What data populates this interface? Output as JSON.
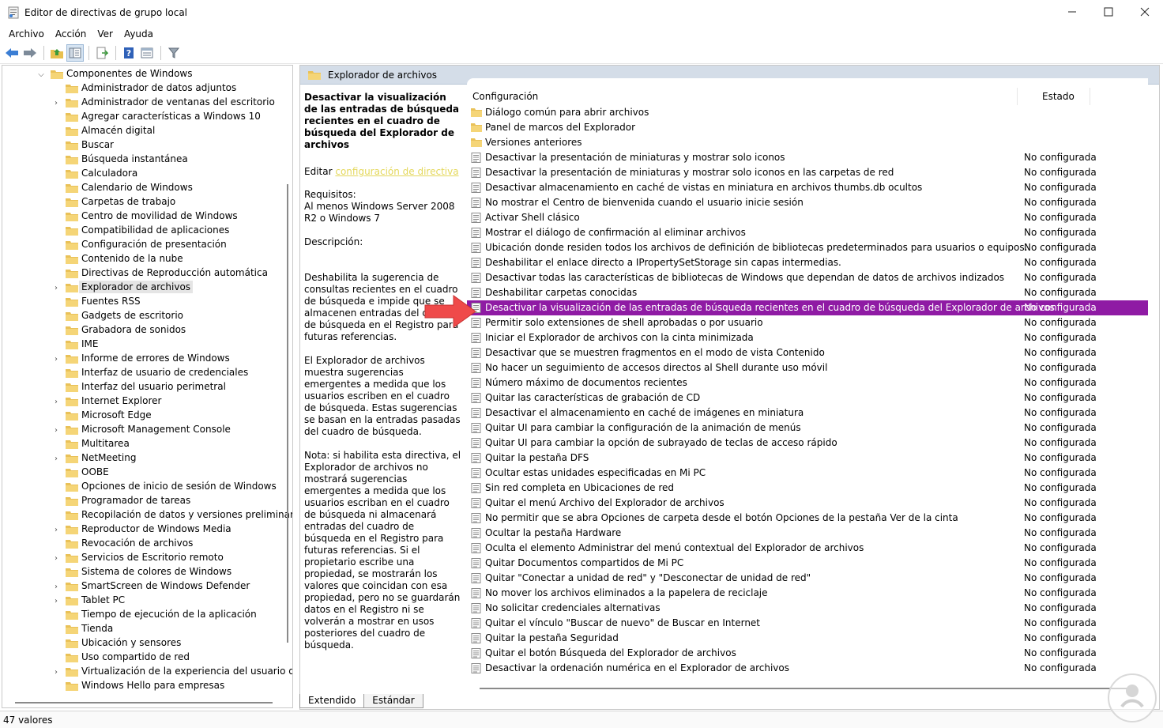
{
  "window": {
    "title": "Editor de directivas de grupo local",
    "minimize_icon": "minimize-icon",
    "maximize_icon": "maximize-icon",
    "close_icon": "close-icon"
  },
  "menu": [
    "Archivo",
    "Acción",
    "Ver",
    "Ayuda"
  ],
  "toolbar": [
    "back-arrow-icon",
    "forward-arrow-icon",
    "up-folder-icon",
    "show-hide-tree-icon",
    "export-list-icon",
    "help-icon",
    "properties-icon",
    "filter-icon"
  ],
  "tree": {
    "root": "Componentes de Windows",
    "items": [
      {
        "label": "Administrador de datos adjuntos",
        "expandable": false
      },
      {
        "label": "Administrador de ventanas del escritorio",
        "expandable": true
      },
      {
        "label": "Agregar características a Windows 10",
        "expandable": false
      },
      {
        "label": "Almacén digital",
        "expandable": false
      },
      {
        "label": "Buscar",
        "expandable": false
      },
      {
        "label": "Búsqueda instantánea",
        "expandable": false
      },
      {
        "label": "Calculadora",
        "expandable": false
      },
      {
        "label": "Calendario de Windows",
        "expandable": false
      },
      {
        "label": "Carpetas de trabajo",
        "expandable": false
      },
      {
        "label": "Centro de movilidad de Windows",
        "expandable": false
      },
      {
        "label": "Compatibilidad de aplicaciones",
        "expandable": false
      },
      {
        "label": "Configuración de presentación",
        "expandable": false
      },
      {
        "label": "Contenido de la nube",
        "expandable": false
      },
      {
        "label": "Directivas de Reproducción automática",
        "expandable": false
      },
      {
        "label": "Explorador de archivos",
        "expandable": true,
        "selected": true
      },
      {
        "label": "Fuentes RSS",
        "expandable": false
      },
      {
        "label": "Gadgets de escritorio",
        "expandable": false
      },
      {
        "label": "Grabadora de sonidos",
        "expandable": false
      },
      {
        "label": "IME",
        "expandable": false
      },
      {
        "label": "Informe de errores de Windows",
        "expandable": true
      },
      {
        "label": "Interfaz de usuario de credenciales",
        "expandable": false
      },
      {
        "label": "Interfaz del usuario perimetral",
        "expandable": false
      },
      {
        "label": "Internet Explorer",
        "expandable": true
      },
      {
        "label": "Microsoft Edge",
        "expandable": false
      },
      {
        "label": "Microsoft Management Console",
        "expandable": true
      },
      {
        "label": "Multitarea",
        "expandable": false
      },
      {
        "label": "NetMeeting",
        "expandable": true
      },
      {
        "label": "OOBE",
        "expandable": false
      },
      {
        "label": "Opciones de inicio de sesión de Windows",
        "expandable": false
      },
      {
        "label": "Programador de tareas",
        "expandable": false
      },
      {
        "label": "Recopilación de datos y versiones preliminares",
        "expandable": false
      },
      {
        "label": "Reproductor de Windows Media",
        "expandable": true
      },
      {
        "label": "Revocación de archivos",
        "expandable": false
      },
      {
        "label": "Servicios de Escritorio remoto",
        "expandable": true
      },
      {
        "label": "Sistema de colores de Windows",
        "expandable": false
      },
      {
        "label": "SmartScreen de Windows Defender",
        "expandable": true
      },
      {
        "label": "Tablet PC",
        "expandable": true
      },
      {
        "label": "Tiempo de ejecución de la aplicación",
        "expandable": false
      },
      {
        "label": "Tienda",
        "expandable": false
      },
      {
        "label": "Ubicación y sensores",
        "expandable": false
      },
      {
        "label": "Uso compartido de red",
        "expandable": false
      },
      {
        "label": "Virtualización de la experiencia del usuario de M",
        "expandable": true
      },
      {
        "label": "Windows Hello para empresas",
        "expandable": false
      }
    ]
  },
  "right_header": "Explorador de archivos",
  "description": {
    "title": "Desactivar la visualización de las entradas de búsqueda recientes en el cuadro de búsqueda del Explorador de archivos",
    "edit_prefix": "Editar",
    "edit_link": "configuración de directiva",
    "requirements_label": "Requisitos:",
    "requirements_text": "Al menos Windows Server 2008 R2 o Windows 7",
    "description_label": "Descripción:",
    "para1": "Deshabilita la sugerencia de consultas recientes en el cuadro de búsqueda e impide que se almacenen entradas del cuadro de búsqueda en el Registro para futuras referencias.",
    "para2": "El Explorador de archivos muestra sugerencias emergentes a medida que los usuarios escriben en el cuadro de búsqueda.  Estas sugerencias se basan en la entradas pasadas del cuadro de búsqueda.",
    "para3": "Nota: si habilita esta directiva, el Explorador de archivos no mostrará sugerencias emergentes a medida que los usuarios escriban en el cuadro de búsqueda ni almacenará entradas del cuadro de búsqueda en el Registro para futuras referencias.  Si el propietario escribe una propiedad, se mostrarán los valores que coincidan con esa propiedad, pero no se guardarán datos en el Registro ni se volverán a mostrar en usos posteriores del cuadro de búsqueda."
  },
  "list": {
    "col_setting": "Configuración",
    "col_state": "Estado",
    "rows": [
      {
        "type": "folder",
        "name": "Diálogo común para abrir archivos",
        "state": ""
      },
      {
        "type": "folder",
        "name": "Panel de marcos del Explorador",
        "state": ""
      },
      {
        "type": "folder",
        "name": "Versiones anteriores",
        "state": ""
      },
      {
        "type": "policy",
        "name": "Desactivar la presentación de miniaturas y mostrar solo iconos",
        "state": "No configurada"
      },
      {
        "type": "policy",
        "name": "Desactivar la presentación de miniaturas y mostrar solo iconos en las carpetas de red",
        "state": "No configurada"
      },
      {
        "type": "policy",
        "name": "Desactivar almacenamiento en caché de vistas en miniatura en archivos thumbs.db ocultos",
        "state": "No configurada"
      },
      {
        "type": "policy",
        "name": "No mostrar el Centro de bienvenida cuando el usuario inicie sesión",
        "state": "No configurada"
      },
      {
        "type": "policy",
        "name": "Activar Shell clásico",
        "state": "No configurada"
      },
      {
        "type": "policy",
        "name": "Mostrar el diálogo de confirmación al eliminar archivos",
        "state": "No configurada"
      },
      {
        "type": "policy",
        "name": "Ubicación donde residen todos los archivos de definición de bibliotecas predeterminados para usuarios o equipos.",
        "state": "No configurada"
      },
      {
        "type": "policy",
        "name": "Deshabilitar el enlace directo a IPropertySetStorage sin capas intermedias.",
        "state": "No configurada"
      },
      {
        "type": "policy",
        "name": "Desactivar todas las características de bibliotecas de Windows que dependan de datos de archivos indizados",
        "state": "No configurada"
      },
      {
        "type": "policy",
        "name": "Deshabilitar carpetas conocidas",
        "state": "No configurada"
      },
      {
        "type": "policy",
        "name": "Desactivar la visualización de las entradas de búsqueda recientes en el cuadro de búsqueda del Explorador de archivos",
        "state": "No configurada",
        "selected": true
      },
      {
        "type": "policy",
        "name": "Permitir solo extensiones de shell aprobadas o por usuario",
        "state": "No configurada"
      },
      {
        "type": "policy",
        "name": "Iniciar el Explorador de archivos con la cinta minimizada",
        "state": "No configurada"
      },
      {
        "type": "policy",
        "name": "Desactivar que se muestren fragmentos en el modo de vista Contenido",
        "state": "No configurada"
      },
      {
        "type": "policy",
        "name": "No hacer un seguimiento de accesos directos al Shell durante uso móvil",
        "state": "No configurada"
      },
      {
        "type": "policy",
        "name": "Número máximo de documentos recientes",
        "state": "No configurada"
      },
      {
        "type": "policy",
        "name": "Quitar las características de grabación de CD",
        "state": "No configurada"
      },
      {
        "type": "policy",
        "name": "Desactivar el almacenamiento en caché de imágenes en miniatura",
        "state": "No configurada"
      },
      {
        "type": "policy",
        "name": "Quitar UI para cambiar la configuración de la animación de menús",
        "state": "No configurada"
      },
      {
        "type": "policy",
        "name": "Quitar UI para cambiar la opción de subrayado de teclas de acceso rápido",
        "state": "No configurada"
      },
      {
        "type": "policy",
        "name": "Quitar la pestaña DFS",
        "state": "No configurada"
      },
      {
        "type": "policy",
        "name": "Ocultar estas unidades especificadas en Mi PC",
        "state": "No configurada"
      },
      {
        "type": "policy",
        "name": "Sin red completa en Ubicaciones de red",
        "state": "No configurada"
      },
      {
        "type": "policy",
        "name": "Quitar el menú Archivo del Explorador de archivos",
        "state": "No configurada"
      },
      {
        "type": "policy",
        "name": "No permitir que se abra Opciones de carpeta desde el botón Opciones de la pestaña Ver de la cinta",
        "state": "No configurada"
      },
      {
        "type": "policy",
        "name": "Ocultar la pestaña Hardware",
        "state": "No configurada"
      },
      {
        "type": "policy",
        "name": "Oculta el elemento Administrar del menú contextual del Explorador de archivos",
        "state": "No configurada"
      },
      {
        "type": "policy",
        "name": "Quitar Documentos compartidos de Mi PC",
        "state": "No configurada"
      },
      {
        "type": "policy",
        "name": "Quitar \"Conectar a unidad de red\" y \"Desconectar de unidad de red\"",
        "state": "No configurada"
      },
      {
        "type": "policy",
        "name": "No mover los archivos eliminados a la papelera de reciclaje",
        "state": "No configurada"
      },
      {
        "type": "policy",
        "name": "No solicitar credenciales alternativas",
        "state": "No configurada"
      },
      {
        "type": "policy",
        "name": "Quitar el vínculo \"Buscar de nuevo\" de Buscar en Internet",
        "state": "No configurada"
      },
      {
        "type": "policy",
        "name": "Quitar la pestaña Seguridad",
        "state": "No configurada"
      },
      {
        "type": "policy",
        "name": "Quitar el botón Búsqueda del Explorador de archivos",
        "state": "No configurada"
      },
      {
        "type": "policy",
        "name": "Desactivar la ordenación numérica en el Explorador de archivos",
        "state": "No configurada"
      }
    ]
  },
  "tabs": [
    "Extendido",
    "Estándar"
  ],
  "status": "47 valores",
  "colors": {
    "selection": "#8f1ba4",
    "header_bg": "#d4dde8",
    "link": "#e4d85c",
    "arrow": "#ef4a4a"
  }
}
